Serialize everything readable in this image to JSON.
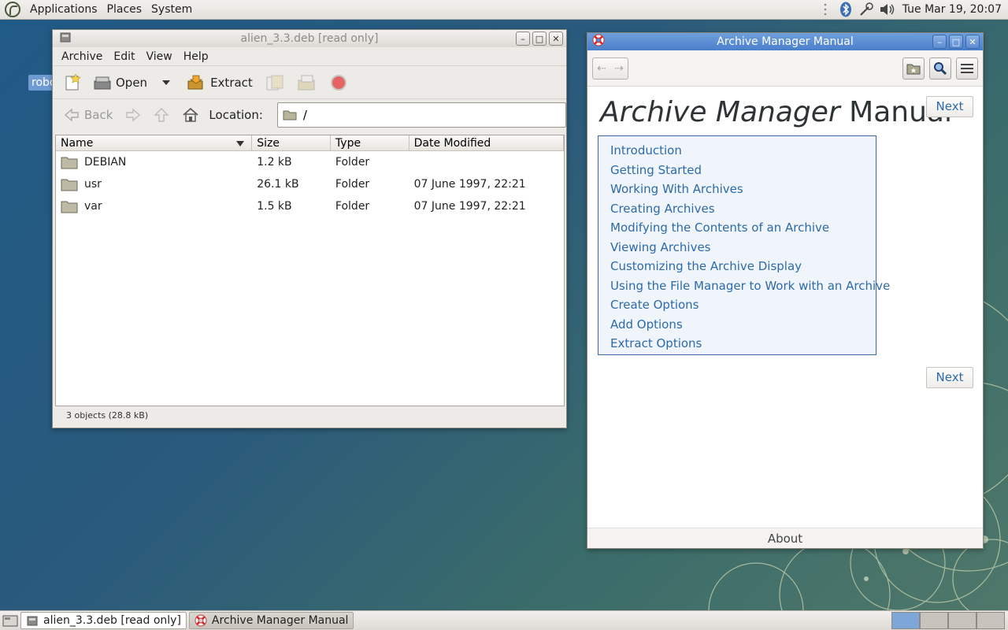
{
  "top_panel": {
    "menus": [
      "Applications",
      "Places",
      "System"
    ],
    "clock": "Tue Mar 19, 20:07"
  },
  "desktop": {
    "icon_label": "robo"
  },
  "archive_window": {
    "title": "alien_3.3.deb [read only]",
    "menus": [
      "Archive",
      "Edit",
      "View",
      "Help"
    ],
    "toolbar": {
      "open": "Open",
      "extract": "Extract"
    },
    "locbar": {
      "back": "Back",
      "location_label": "Location:",
      "location_value": "/"
    },
    "columns": [
      "Name",
      "Size",
      "Type",
      "Date Modified"
    ],
    "rows": [
      {
        "name": "DEBIAN",
        "size": "1.2 kB",
        "type": "Folder",
        "date": ""
      },
      {
        "name": "usr",
        "size": "26.1 kB",
        "type": "Folder",
        "date": "07 June 1997, 22:21"
      },
      {
        "name": "var",
        "size": "1.5 kB",
        "type": "Folder",
        "date": "07 June 1997, 22:21"
      }
    ],
    "status": "3 objects (28.8 kB)"
  },
  "help_window": {
    "title": "Archive Manager Manual",
    "heading_italic": "Archive Manager",
    "heading_rest": " Manual",
    "next": "Next",
    "toc": [
      "Introduction",
      "Getting Started",
      "Working With Archives",
      "Creating Archives",
      "Modifying the Contents of an Archive",
      "Viewing Archives",
      "Customizing the Archive Display",
      "Using the File Manager to Work with an Archive",
      "Create Options",
      "Add Options",
      "Extract Options"
    ],
    "about": "About"
  },
  "taskbar": {
    "tasks": [
      "alien_3.3.deb [read only]",
      "Archive Manager Manual"
    ]
  },
  "colors": {
    "help_titlebar": "#5a8ad0",
    "link": "#2c6aa8",
    "toc_border": "#3d66a6"
  }
}
